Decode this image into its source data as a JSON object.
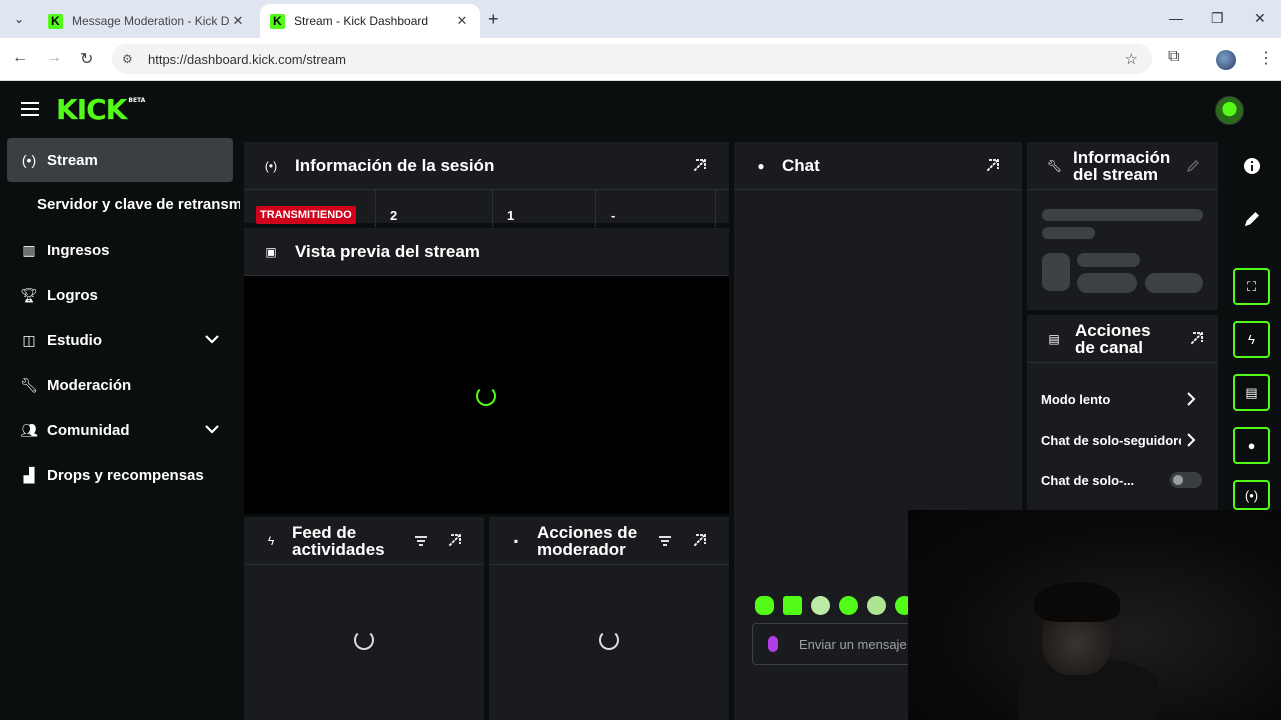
{
  "browser": {
    "tabs": [
      {
        "label": "Message Moderation - Kick Da",
        "active": false
      },
      {
        "label": "Stream - Kick Dashboard",
        "active": true
      }
    ],
    "url": "https://dashboard.kick.com/stream"
  },
  "header": {
    "logo": "KICK",
    "logo_badge": "BETA"
  },
  "sidebar": {
    "items": [
      {
        "label": "Stream",
        "icon": "broadcast-icon",
        "active": true
      },
      {
        "label": "Servidor y clave de retransmisión",
        "sub": true
      },
      {
        "label": "Ingresos",
        "icon": "chart-icon"
      },
      {
        "label": "Logros",
        "icon": "trophy-icon"
      },
      {
        "label": "Estudio",
        "icon": "studio-icon",
        "expandable": true
      },
      {
        "label": "Moderación",
        "icon": "wrench-icon"
      },
      {
        "label": "Comunidad",
        "icon": "users-icon",
        "expandable": true
      },
      {
        "label": "Drops y recompensas",
        "icon": "gift-icon"
      }
    ]
  },
  "session": {
    "title": "Información de la sesión",
    "status_badge": "TRANSMITIENDO",
    "stats": [
      "2",
      "1",
      "-"
    ]
  },
  "preview": {
    "title": "Vista previa del stream"
  },
  "activity": {
    "title_line1": "Feed de",
    "title_line2": "actividades"
  },
  "mod_actions": {
    "title_line1": "Acciones de",
    "title_line2": "moderador"
  },
  "chat": {
    "title": "Chat",
    "placeholder": "Enviar un mensaje"
  },
  "stream_info": {
    "title_line1": "Información",
    "title_line2": "del stream"
  },
  "channel_actions": {
    "title_line1": "Acciones",
    "title_line2": "de canal",
    "rows": [
      "Modo lento",
      "Chat de solo-seguidores",
      "Chat de solo-..."
    ]
  },
  "colors": {
    "accent": "#53fc18",
    "live": "#d0021b",
    "panel": "#191b1f"
  }
}
